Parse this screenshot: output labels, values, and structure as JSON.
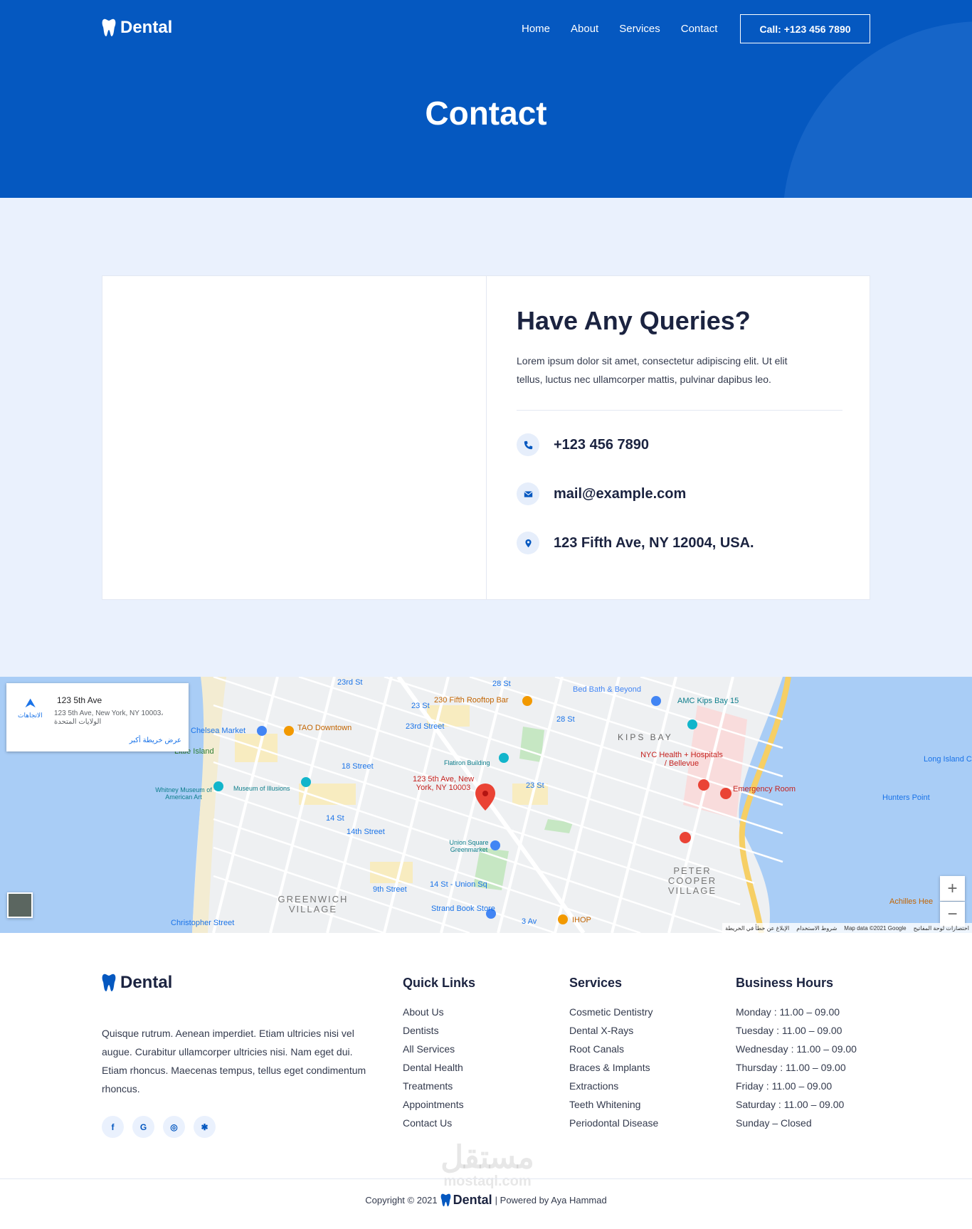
{
  "brand": {
    "name": "Dental",
    "colors": {
      "primary": "#0558c0",
      "light_bg": "#eaf1fd",
      "dark_text": "#1b2340"
    }
  },
  "nav": {
    "links": [
      "Home",
      "About",
      "Services",
      "Contact"
    ],
    "call_label": "Call: +123 456 7890"
  },
  "hero": {
    "title": "Contact"
  },
  "contact": {
    "title": "Have Any Queries?",
    "text": "Lorem ipsum dolor sit amet, consectetur adipiscing elit. Ut elit tellus, luctus nec ullamcorper mattis, pulvinar dapibus leo.",
    "phone": "+123 456 7890",
    "email": "mail@example.com",
    "address": "123 Fifth Ave, NY 12004, USA.",
    "icons": {
      "phone": "phone-icon",
      "email": "envelope-icon",
      "address": "map-pin-icon"
    }
  },
  "map": {
    "card": {
      "place": "123 5th Ave",
      "address": "123 5th Ave, New York, NY 10003، الولايات المتحدة",
      "directions": "الاتجاهات",
      "bigger_map": "عرض خريطة أكبر"
    },
    "marker_label": "123 5th Ave, New York, NY 10003",
    "labels": {
      "bed_bath": "Bed Bath & Beyond",
      "rooftop": "230 Fifth Rooftop Bar",
      "amc": "AMC Kips Bay 15",
      "kips_bay": "KIPS BAY",
      "nyc_health": "NYC Health + Hospitals / Bellevue",
      "emergency": "Emergency Room",
      "chelsea": "Chelsea Market",
      "tao": "TAO Downtown",
      "little_island": "Little Island",
      "flatiron": "Flatiron Building",
      "illusions": "Museum of Illusions",
      "whitney": "Whitney Museum of American Art",
      "union_square": "Union Square Greenmarket",
      "strand": "Strand Book Store",
      "greenwich": "GREENWICH VILLAGE",
      "peter_cooper": "PETER COOPER VILLAGE",
      "long_island": "Long Island City",
      "hunters_point": "Hunters Point",
      "christopher": "Christopher Street",
      "ihop": "IHOP",
      "achilles": "Achilles Hee",
      "street_28": "28 St",
      "street_23": "23 St",
      "street_23rd": "23rd Street",
      "street_18": "18 Street",
      "street_14": "14 St",
      "street_14th": "14th Street",
      "street_14_union": "14 St - Union Sq",
      "street_9th": "9th Street",
      "street_3av": "3 Av",
      "street_23rd_st": "23rd St"
    },
    "attribution": {
      "report": "الإبلاغ عن خطأ في الخريطة",
      "terms": "شروط الاستخدام",
      "data": "Map data ©2021 Google",
      "shortcuts": "اختصارات لوحة المفاتيح"
    },
    "zoom_in": "+",
    "zoom_out": "−"
  },
  "footer": {
    "about": "Quisque rutrum. Aenean imperdiet. Etiam ultricies nisi vel augue. Curabitur ullamcorper ultricies nisi. Nam eget dui. Etiam rhoncus. Maecenas tempus, tellus eget condimentum rhoncus.",
    "socials": [
      "facebook-icon",
      "google-icon",
      "instagram-icon",
      "yelp-icon"
    ],
    "quick_links": {
      "title": "Quick Links",
      "items": [
        "About Us",
        "Dentists",
        "All Services",
        "Dental Health",
        "Treatments",
        "Appointments",
        "Contact Us"
      ]
    },
    "services": {
      "title": "Services",
      "items": [
        "Cosmetic Dentistry",
        "Dental X-Rays",
        "Root Canals",
        "Braces & Implants",
        "Extractions",
        "Teeth Whitening",
        "Periodontal Disease"
      ]
    },
    "hours": {
      "title": "Business Hours",
      "items": [
        "Monday : 11.00 – 09.00",
        "Tuesday : 11.00 – 09.00",
        "Wednesday : 11.00 – 09.00",
        "Thursday : 11.00 – 09.00",
        "Friday : 11.00 – 09.00",
        "Saturday : 11.00 – 09.00",
        "Sunday – Closed"
      ]
    },
    "copyright_prefix": "Copyright © 2021",
    "powered_by": "| Powered by Aya Hammad",
    "watermark": {
      "main": "مستقل",
      "sub": "mostaql.com"
    }
  }
}
